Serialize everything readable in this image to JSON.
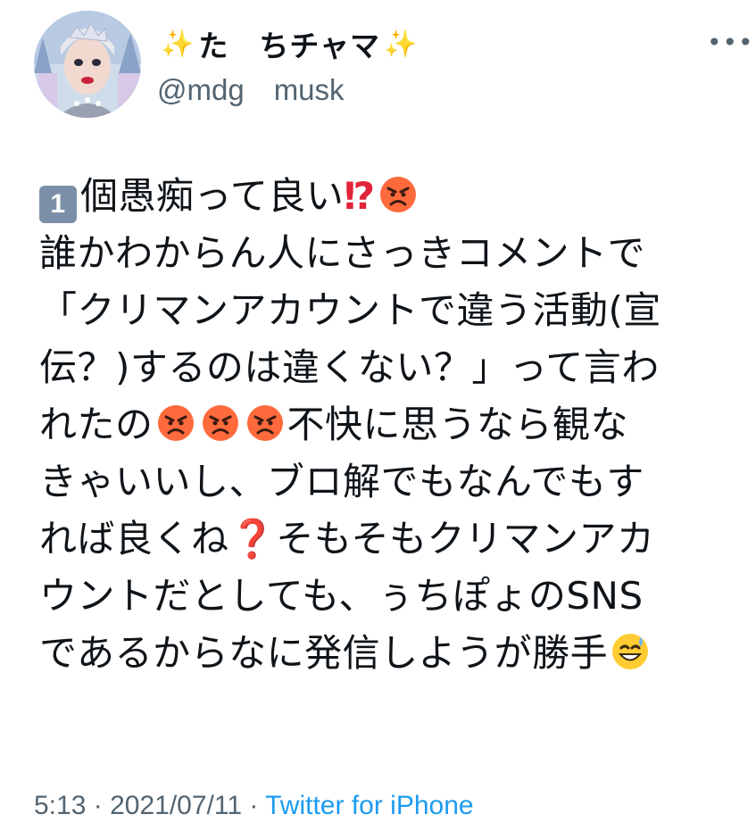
{
  "user": {
    "display_name": "た　ちチャマ",
    "handle": "@mdg　musk"
  },
  "more_icon": "more-horizontal-icon",
  "tweet_lines": [
    "個愚痴って良い",
    "誰かわからん人にさっきコメントで",
    "「クリマンアカウントで違う活動(宣",
    "伝？)するのは違くない？」って言わ",
    "れたの",
    "不快に思うなら観な",
    "きゃいいし、ブロ解でもなんでもす",
    "れば良くね",
    "そもそもクリマンアカ",
    "ウントだとしても、ぅちぽょのSNS",
    "であるからなに発信しようが勝手"
  ],
  "keycap_number": "1",
  "exclamation_question": "⁉",
  "red_question": "❓",
  "footer": {
    "time": "5:13",
    "date": "2021/07/11",
    "separator": "·",
    "source": "Twitter for iPhone"
  },
  "colors": {
    "text": "#0f1419",
    "secondary": "#536471",
    "link": "#1d9bf0",
    "emoji_red": "#e0243a"
  }
}
